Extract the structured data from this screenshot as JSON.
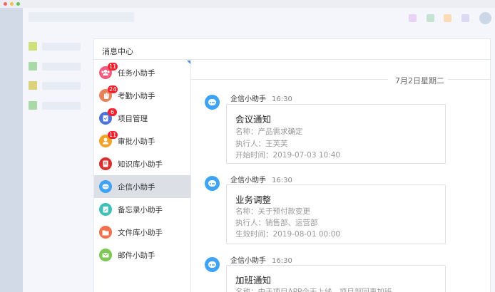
{
  "colors": {
    "top_squares": [
      "#e8d3f5",
      "#c4e3d2",
      "#fbdcb6",
      "#dcd9f5"
    ],
    "nav_squares": [
      "#cfe07a",
      "#a9d9a8",
      "#dcd27c",
      "#a9d9a8"
    ],
    "window_dots": [
      "#ee6a5e",
      "#f4be4f",
      "#61c554"
    ]
  },
  "panel": {
    "title": "消息中心"
  },
  "categories": [
    {
      "label": "任务小助手",
      "icon": "people-icon",
      "color": "#f05a7e",
      "badge": "11"
    },
    {
      "label": "考勤小助手",
      "icon": "hand-icon",
      "color": "#e8825a",
      "badge": "24"
    },
    {
      "label": "项目管理",
      "icon": "clipboard-icon",
      "color": "#4e73d8",
      "badge": "6"
    },
    {
      "label": "审批小助手",
      "icon": "person-icon",
      "color": "#f3a32a",
      "badge": "11"
    },
    {
      "label": "知识库小助手",
      "icon": "book-icon",
      "color": "#d93030",
      "badge": ""
    },
    {
      "label": "企信小助手",
      "icon": "chat-icon",
      "color": "#3ea3f5",
      "badge": ""
    },
    {
      "label": "备忘录小助手",
      "icon": "memo-icon",
      "color": "#41c0b8",
      "badge": ""
    },
    {
      "label": "文件库小助手",
      "icon": "folder-icon",
      "color": "#f4714e",
      "badge": ""
    },
    {
      "label": "邮件小助手",
      "icon": "mail-icon",
      "color": "#7cc853",
      "badge": ""
    }
  ],
  "date_divider": "7月2日星期二",
  "messages": [
    {
      "sender": "企信小助手",
      "time": "16:30",
      "title": "会议通知",
      "fields": [
        "名称：产品需求确定",
        "执行人：王芙芙",
        "开始时间：2019-07-03 10:40"
      ]
    },
    {
      "sender": "企信小助手",
      "time": "16:30",
      "title": "业务调整",
      "fields": [
        "名称：关于预付款变更",
        "执行人：销售部、运营部",
        "生效时间：2019-08-01 00:00"
      ]
    },
    {
      "sender": "企信小助手",
      "time": "16:30",
      "title": "加班通知",
      "fields": [
        "名称：由于项目APP今天上线，项目部同事加班"
      ]
    }
  ]
}
